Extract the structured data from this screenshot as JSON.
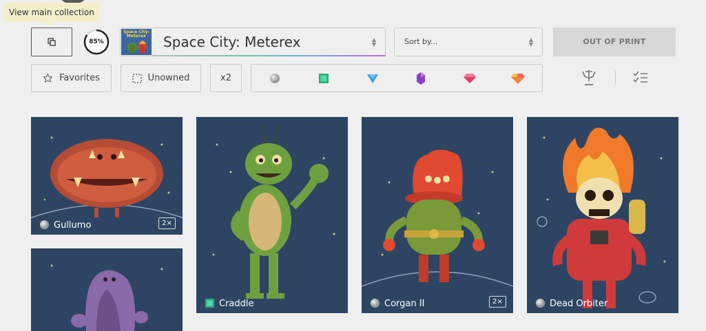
{
  "tooltip": {
    "text": "View main collection"
  },
  "toolbar": {
    "progress_label": "85%",
    "progress_value": 0.85,
    "set_select": {
      "value": "Space City: Meterex",
      "thumb_text": "Space City: Meterex"
    },
    "sort_select": {
      "placeholder": "Sort by..."
    },
    "status_label": "OUT OF PRINT"
  },
  "filters": {
    "favorites_label": "Favorites",
    "unowned_label": "Unowned",
    "duplicates_label": "x2",
    "rarities": [
      {
        "name": "common",
        "color": "#b5b5b5"
      },
      {
        "name": "uncommon",
        "color": "#34c58e"
      },
      {
        "name": "rare",
        "color": "#3a9de8"
      },
      {
        "name": "epic",
        "color": "#9b4fd6"
      },
      {
        "name": "legendary",
        "color": "#e83a6b"
      },
      {
        "name": "mythic",
        "color": "#f08a5d"
      }
    ]
  },
  "cards": [
    {
      "name": "Gullumo",
      "rarity": "common",
      "badge": "2×"
    },
    {
      "name": "Craddle",
      "rarity": "uncommon",
      "badge": ""
    },
    {
      "name": "Corgan II",
      "rarity": "common",
      "badge": "2×"
    },
    {
      "name": "Dead Orbiter",
      "rarity": "common",
      "badge": ""
    },
    {
      "name": "",
      "rarity": "",
      "badge": ""
    }
  ]
}
